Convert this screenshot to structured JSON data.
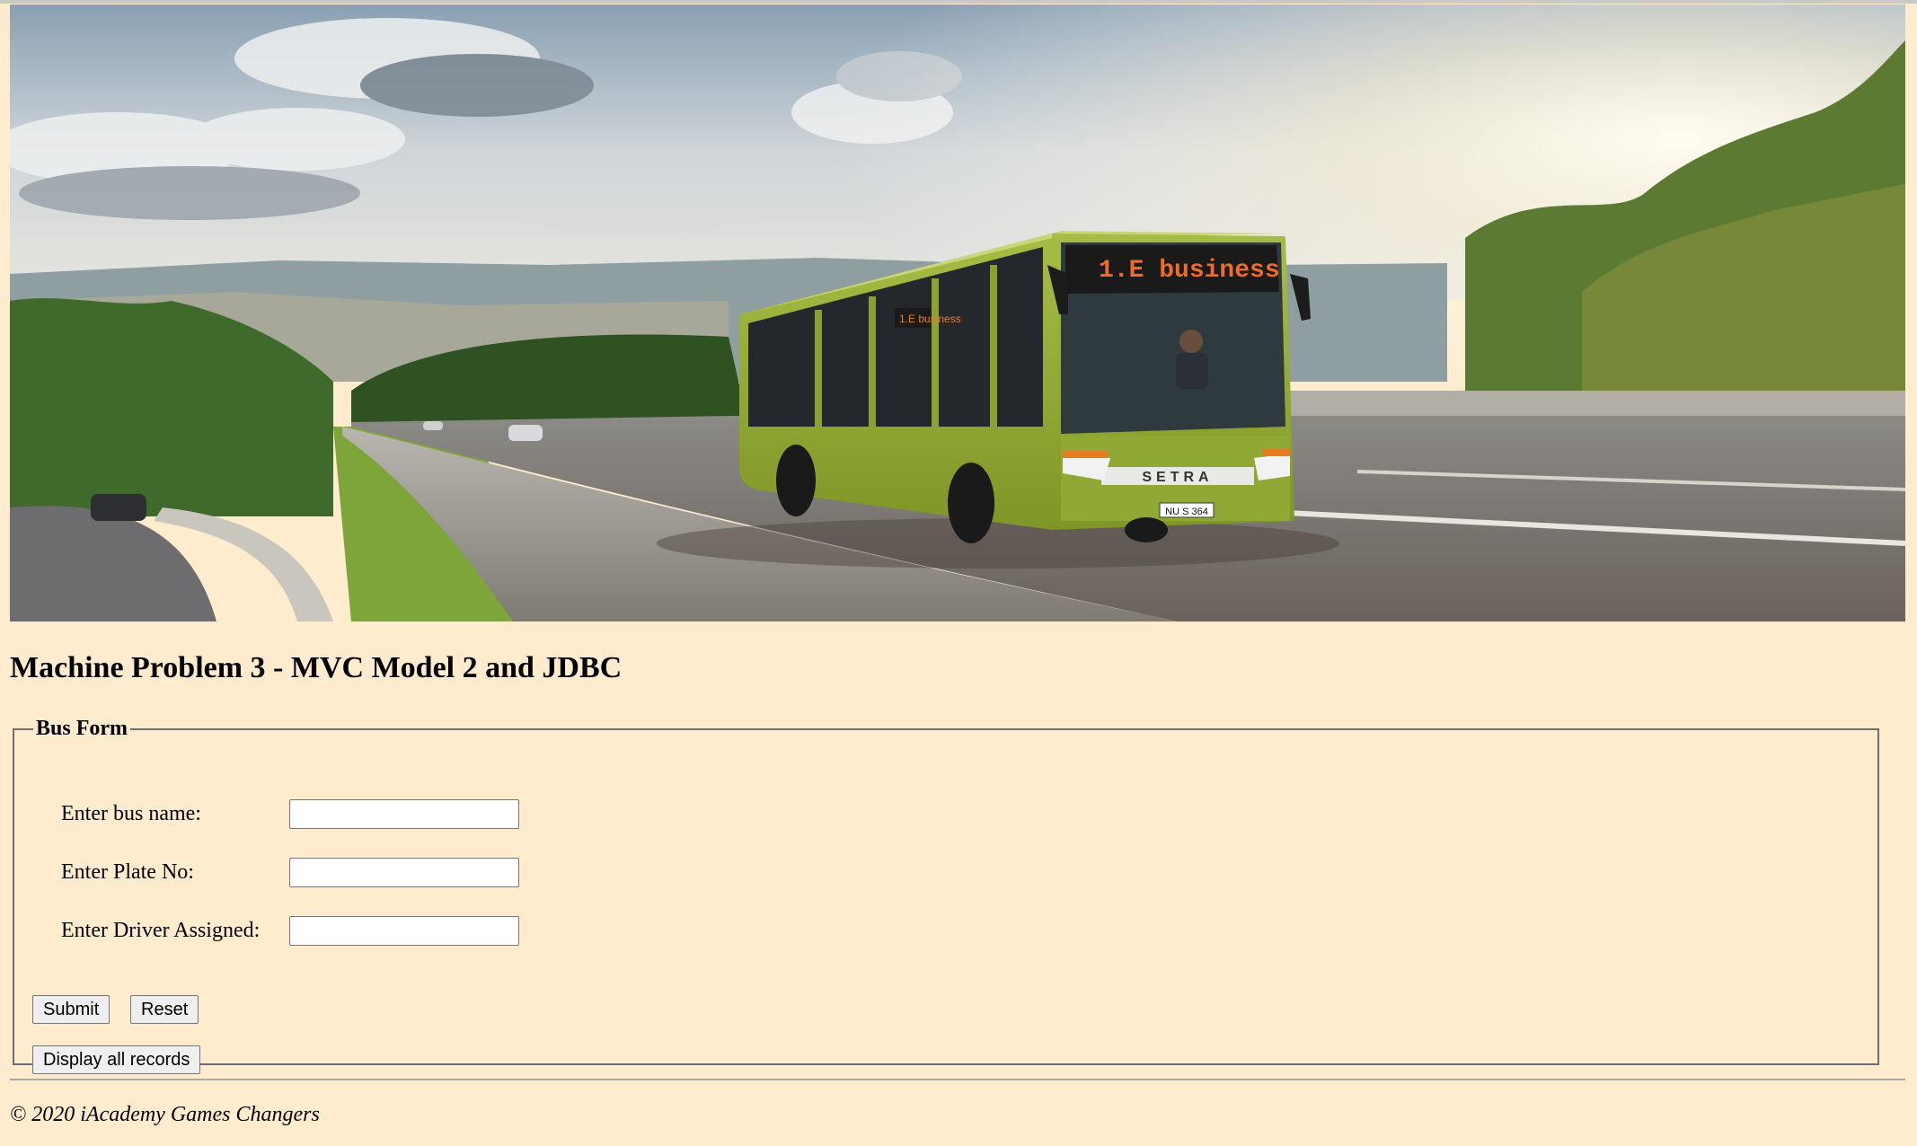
{
  "banner": {
    "bus_sign": "1.E business",
    "bus_side_sign": "1.E business",
    "bus_brand": "SETRA",
    "bus_plate": "NU S 364"
  },
  "page": {
    "title": "Machine Problem 3 - MVC Model 2 and JDBC"
  },
  "form": {
    "legend": "Bus Form",
    "fields": [
      {
        "label": "Enter bus name:",
        "value": "",
        "placeholder": ""
      },
      {
        "label": "Enter Plate No:",
        "value": "",
        "placeholder": ""
      },
      {
        "label": "Enter Driver Assigned:",
        "value": "",
        "placeholder": ""
      }
    ],
    "submit_label": "Submit",
    "reset_label": "Reset",
    "display_label": "Display all records"
  },
  "footer": {
    "text": "© 2020 iAcademy Games Changers"
  },
  "colors": {
    "page_background": "#ffebcd",
    "bus_body": "#8aa32f"
  }
}
